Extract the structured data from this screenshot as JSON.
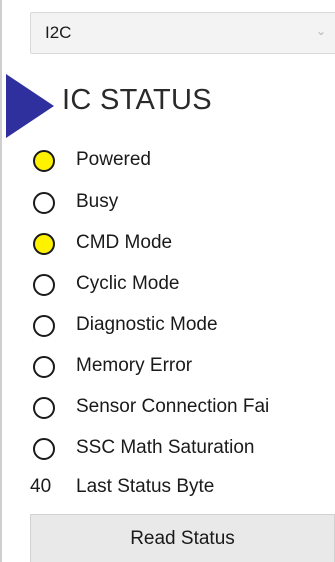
{
  "interface_select": {
    "value": "I2C",
    "icon": "chevron-down-icon"
  },
  "section": {
    "title": "IC STATUS",
    "pointer_color": "#2f2f9e"
  },
  "status_items": [
    {
      "label": "Powered",
      "active": true
    },
    {
      "label": "Busy",
      "active": false
    },
    {
      "label": "CMD Mode",
      "active": true
    },
    {
      "label": "Cyclic Mode",
      "active": false
    },
    {
      "label": "Diagnostic Mode",
      "active": false
    },
    {
      "label": "Memory Error",
      "active": false
    },
    {
      "label": "Sensor Connection Fai",
      "active": false
    },
    {
      "label": "SSC Math Saturation",
      "active": false
    }
  ],
  "last_status_byte": {
    "value": "40",
    "label": "Last Status Byte"
  },
  "colors": {
    "led_on": "#fff200",
    "led_off": "#ffffff"
  },
  "read_button": {
    "label": "Read Status"
  }
}
